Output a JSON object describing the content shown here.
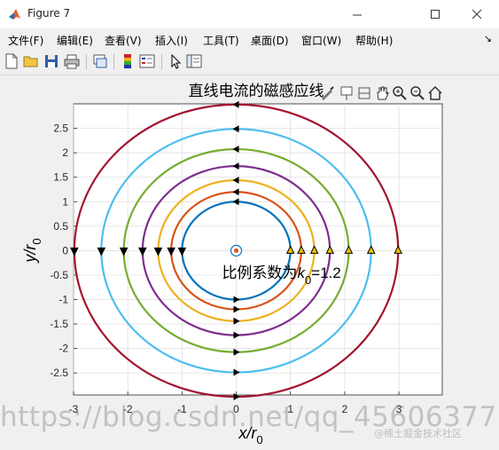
{
  "window": {
    "title": "Figure 7",
    "controls": [
      "minimize-icon",
      "maximize-icon",
      "close-icon"
    ]
  },
  "menu": {
    "items": [
      "文件(F)",
      "编辑(E)",
      "查看(V)",
      "插入(I)",
      "工具(T)",
      "桌面(D)",
      "窗口(W)",
      "帮助(H)"
    ],
    "overflow": "↘"
  },
  "toolbar": {
    "icons": [
      "new-figure-icon",
      "open-file-icon",
      "save-icon",
      "print-icon",
      "link-plot-icon",
      "insert-colorbar-icon",
      "insert-legend-icon",
      "pointer-icon",
      "property-inspector-icon"
    ]
  },
  "axes_toolbar": {
    "icons": [
      "brush-icon",
      "data-cursor-icon",
      "rotate-icon",
      "pan-icon",
      "zoom-in-icon",
      "zoom-out-icon",
      "home-icon"
    ]
  },
  "chart_data": {
    "type": "line",
    "title": "直线电流的磁感应线",
    "xlabel_base": "x/r",
    "xlabel_sub": "0",
    "ylabel_base": "y/r",
    "ylabel_sub": "0",
    "xlim": [
      -3,
      3.8
    ],
    "ylim": [
      -2.95,
      3.0
    ],
    "xticks": [
      -3,
      -2,
      -1,
      0,
      1,
      2,
      3
    ],
    "xtick_labels": [
      "-3",
      "-2",
      "-1",
      "0",
      "1",
      "2",
      "3"
    ],
    "yticks": [
      -2.5,
      -2,
      -1.5,
      -1,
      -0.5,
      0,
      0.5,
      1,
      1.5,
      2,
      2.5
    ],
    "ytick_labels": [
      "-2.5",
      "-2",
      "-1.5",
      "-1",
      "-0.5",
      "0",
      "0.5",
      "1",
      "1.5",
      "2",
      "2.5"
    ],
    "grid": true,
    "annotation_text": "比例系数为",
    "annotation_k": "k",
    "annotation_sub": "0",
    "annotation_value": "=1.2",
    "annotation_at": [
      0.9,
      -0.45
    ],
    "circles": [
      {
        "radius": 1.0,
        "color": "#0072bd"
      },
      {
        "radius": 1.2,
        "color": "#d95319"
      },
      {
        "radius": 1.44,
        "color": "#edb120"
      },
      {
        "radius": 1.728,
        "color": "#7e2f8e"
      },
      {
        "radius": 2.074,
        "color": "#77ac30"
      },
      {
        "radius": 2.488,
        "color": "#4dbeee"
      },
      {
        "radius": 2.986,
        "color": "#a2142f"
      }
    ],
    "arrow_color": "#000000",
    "arrow_fill": "#f0c000",
    "center_marker": {
      "x": 0,
      "y": 0,
      "outer": "#0072bd",
      "inner": "#d95319"
    }
  },
  "overlay": {
    "watermark": "https://blog.csdn.net/qq_45606377",
    "credit": "@稀土掘金技术社区"
  }
}
